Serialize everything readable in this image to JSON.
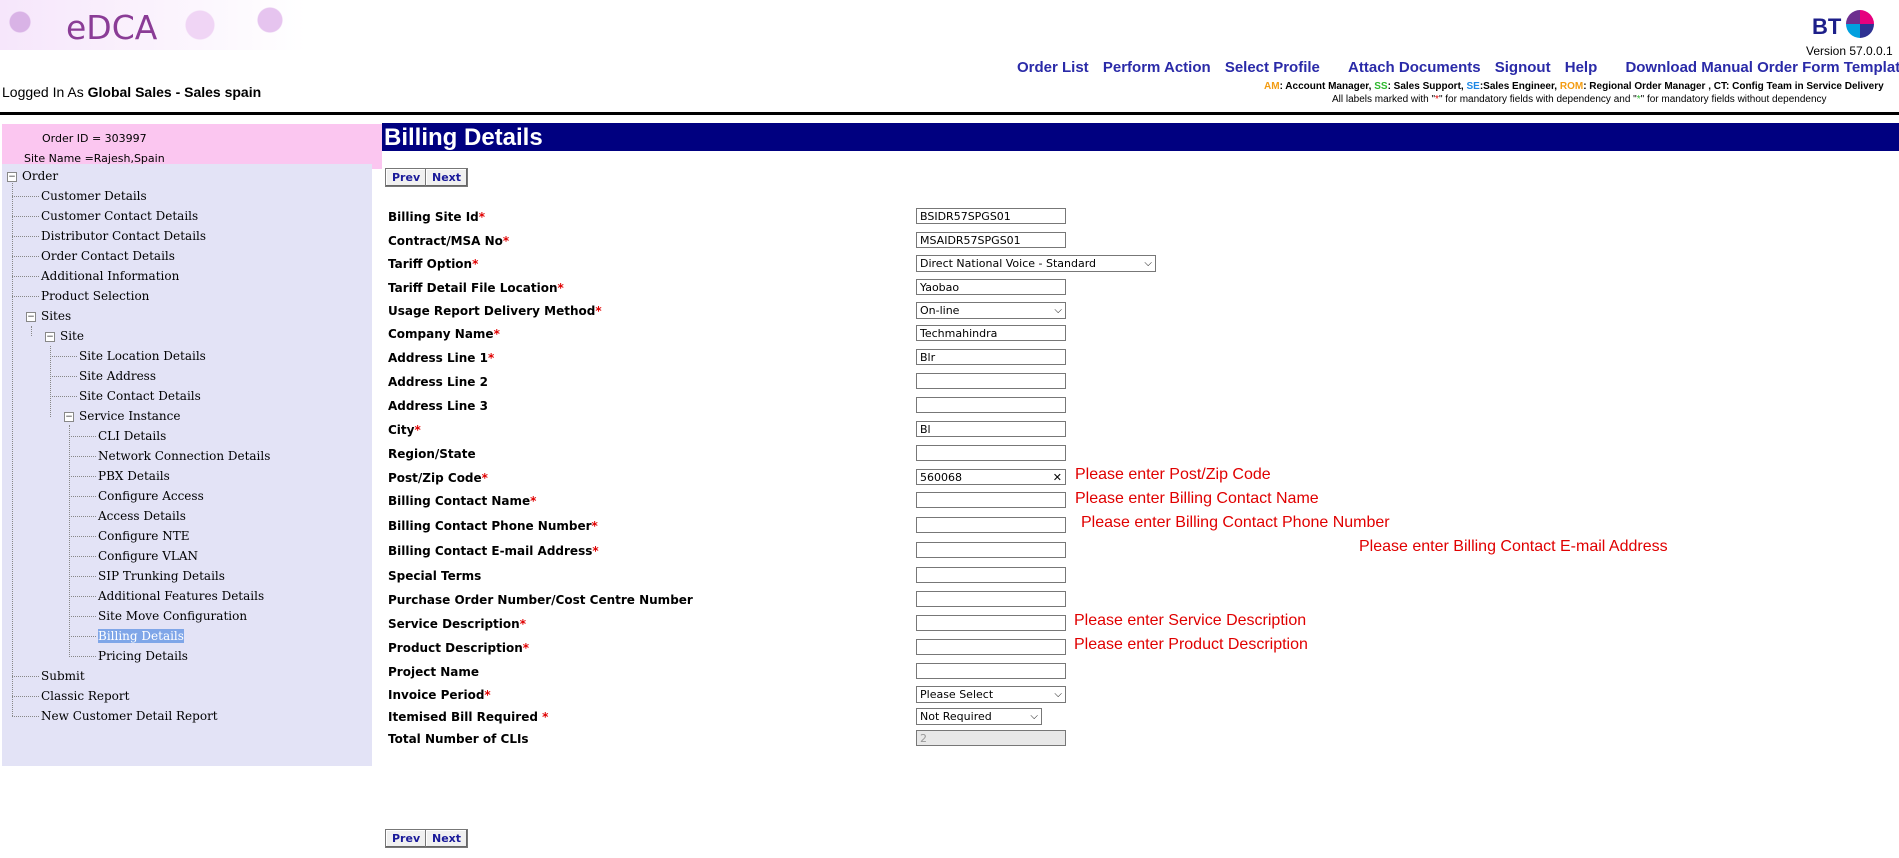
{
  "header": {
    "app_name": "eDCA",
    "brand": "BT",
    "version": "Version 57.0.0.1",
    "links": [
      "Order List",
      "Perform Action",
      "Select Profile",
      "Attach Documents",
      "Signout",
      "Help",
      "Download Manual Order Form Template"
    ],
    "logged_prefix": "Logged In As",
    "logged_user": "Global Sales - Sales spain",
    "legend": {
      "am_abbr": "AM",
      "am_text": ": Account Manager,",
      "ss_abbr": "SS",
      "ss_text": ": Sales Support,",
      "se_abbr": "SE",
      "se_text": ":Sales Engineer,",
      "rom_abbr": "ROM",
      "rom_text": ": Regional Order Manager , CT: Config Team in Service Delivery",
      "line2_a": "All labels marked with \"",
      "line2_star1": "*",
      "line2_b": "\" for mandatory fields with dependency and \"",
      "line2_star2": "*",
      "line2_c": "\" for mandatory fields without dependency"
    }
  },
  "sidebar": {
    "order_id": "Order ID = 303997",
    "site_name": "Site Name =Rajesh,Spain",
    "tree": {
      "order": "Order",
      "customer_details": "Customer Details",
      "customer_contact_details": "Customer Contact Details",
      "distributor_contact_details": "Distributor Contact Details",
      "order_contact_details": "Order Contact Details",
      "additional_information": "Additional Information",
      "product_selection": "Product Selection",
      "sites": "Sites",
      "site": "Site",
      "site_location_details": "Site Location Details",
      "site_address": "Site Address",
      "site_contact_details": "Site Contact Details",
      "service_instance": "Service Instance",
      "cli_details": "CLI Details",
      "network_connection_details": "Network Connection Details",
      "pbx_details": "PBX Details",
      "configure_access": "Configure Access",
      "access_details": "Access Details",
      "configure_nte": "Configure NTE",
      "configure_vlan": "Configure VLAN",
      "sip_trunking_details": "SIP Trunking Details",
      "additional_features_details": "Additional Features Details",
      "site_move_configuration": "Site Move Configuration",
      "billing_details": "Billing Details",
      "pricing_details": "Pricing Details",
      "submit": "Submit",
      "classic_report": "Classic Report",
      "new_customer_detail_report": "New Customer Detail Report"
    }
  },
  "main": {
    "title": "Billing Details",
    "prev": "Prev",
    "next": "Next",
    "required_mark": "*",
    "fields": {
      "billing_site_id": {
        "label": "Billing Site Id",
        "value": "BSIDR57SPGS01"
      },
      "contract_msa": {
        "label": "Contract/MSA No",
        "value": "MSAIDR57SPGS01"
      },
      "tariff_option": {
        "label": "Tariff Option",
        "value": "Direct National Voice - Standard"
      },
      "tariff_detail_file": {
        "label": "Tariff Detail File Location",
        "value": "Yaobao"
      },
      "usage_report": {
        "label": "Usage Report Delivery Method",
        "value": "On-line"
      },
      "company_name": {
        "label": "Company Name",
        "value": "Techmahindra"
      },
      "address1": {
        "label": "Address Line 1",
        "value": "Blr"
      },
      "address2": {
        "label": "Address Line 2",
        "value": ""
      },
      "address3": {
        "label": "Address Line 3",
        "value": ""
      },
      "city": {
        "label": "City",
        "value": "Bl"
      },
      "region": {
        "label": "Region/State",
        "value": ""
      },
      "postcode": {
        "label": "Post/Zip Code",
        "value": "560068",
        "error": "Please enter Post/Zip Code"
      },
      "billing_contact_name": {
        "label": "Billing Contact Name",
        "value": "",
        "error": "Please enter Billing Contact Name"
      },
      "billing_contact_phone": {
        "label": "Billing Contact Phone Number",
        "value": "",
        "error": "Please enter Billing Contact Phone Number"
      },
      "billing_contact_email": {
        "label": "Billing Contact E-mail Address",
        "value": "",
        "error": "Please enter Billing Contact E-mail Address"
      },
      "special_terms": {
        "label": "Special Terms",
        "value": ""
      },
      "purchase_order": {
        "label": "Purchase Order Number/Cost Centre Number",
        "value": ""
      },
      "service_description": {
        "label": "Service Description",
        "value": "",
        "error": "Please enter Service Description"
      },
      "product_description": {
        "label": "Product Description",
        "value": "",
        "error": "Please enter Product Description"
      },
      "project_name": {
        "label": "Project Name",
        "value": ""
      },
      "invoice_period": {
        "label": "Invoice Period",
        "value": "Please Select"
      },
      "itemised_bill": {
        "label": "Itemised Bill Required ",
        "value": "Not Required"
      },
      "total_clis": {
        "label": "Total Number of CLIs",
        "value": "2"
      }
    }
  }
}
